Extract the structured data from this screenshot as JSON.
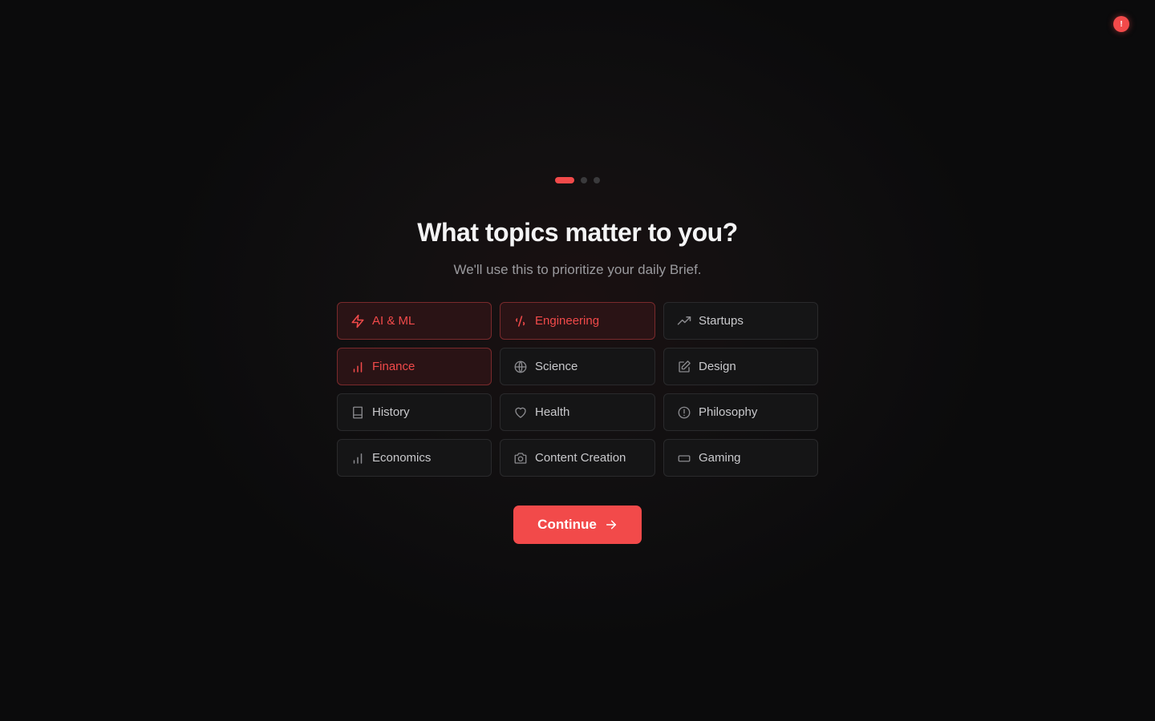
{
  "notification": {
    "badge_glyph": "!"
  },
  "progress": {
    "current_step": 1,
    "total_steps": 3
  },
  "header": {
    "title": "What topics matter to you?",
    "subtitle": "We'll use this to prioritize your daily Brief."
  },
  "topics": [
    {
      "label": "AI & ML",
      "icon": "bolt-icon",
      "selected": true
    },
    {
      "label": "Engineering",
      "icon": "code-icon",
      "selected": true
    },
    {
      "label": "Startups",
      "icon": "trending-up-icon",
      "selected": false
    },
    {
      "label": "Finance",
      "icon": "bar-chart-icon",
      "selected": true
    },
    {
      "label": "Science",
      "icon": "globe-icon",
      "selected": false
    },
    {
      "label": "Design",
      "icon": "edit-icon",
      "selected": false
    },
    {
      "label": "History",
      "icon": "book-icon",
      "selected": false
    },
    {
      "label": "Health",
      "icon": "heart-icon",
      "selected": false
    },
    {
      "label": "Philosophy",
      "icon": "alert-circle-icon",
      "selected": false
    },
    {
      "label": "Economics",
      "icon": "bar-chart-icon",
      "selected": false
    },
    {
      "label": "Content Creation",
      "icon": "camera-icon",
      "selected": false
    },
    {
      "label": "Gaming",
      "icon": "gamepad-icon",
      "selected": false
    }
  ],
  "actions": {
    "continue_label": "Continue"
  },
  "colors": {
    "accent": "#f24a4a",
    "background": "#0b0b0c",
    "selected_bg": "#2a1315",
    "selected_border": "#7a2a2c",
    "card_bg": "#151516",
    "card_border": "#2a2a2c"
  }
}
